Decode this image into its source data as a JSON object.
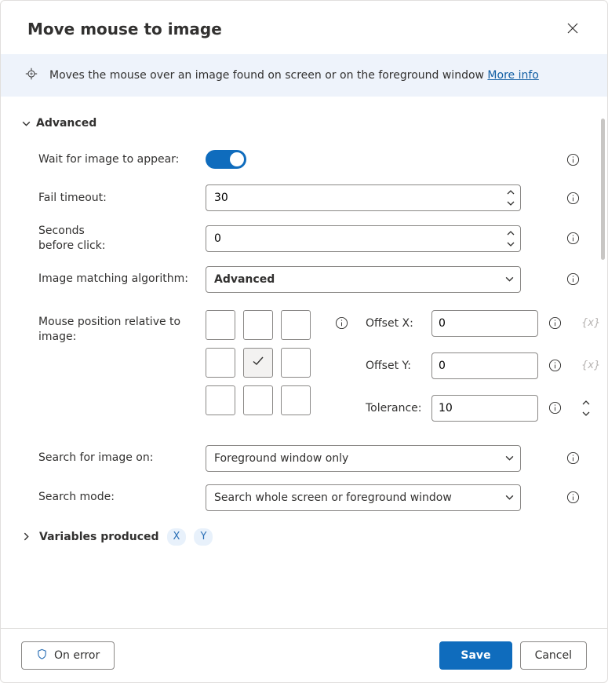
{
  "dialog": {
    "title": "Move mouse to image"
  },
  "banner": {
    "text": "Moves the mouse over an image found on screen or on the foreground window ",
    "more_info": "More info"
  },
  "sections": {
    "advanced": "Advanced",
    "variables_produced": "Variables produced"
  },
  "fields": {
    "wait_for_image": {
      "label": "Wait for image to appear:",
      "value": true
    },
    "fail_timeout": {
      "label": "Fail timeout:",
      "value": "30"
    },
    "seconds_before_click": {
      "label": "Seconds\nbefore click:",
      "value": "0"
    },
    "matching_algorithm": {
      "label": "Image matching algorithm:",
      "value": "Advanced"
    },
    "mouse_position": {
      "label": "Mouse position relative to image:",
      "selected_index": 4
    },
    "offset_x": {
      "label": "Offset X:",
      "value": "0",
      "placeholder": "{x}"
    },
    "offset_y": {
      "label": "Offset Y:",
      "value": "0",
      "placeholder": "{x}"
    },
    "tolerance": {
      "label": "Tolerance:",
      "value": "10"
    },
    "search_on": {
      "label": "Search for image on:",
      "value": "Foreground window only"
    },
    "search_mode": {
      "label": "Search mode:",
      "value": "Search whole screen or foreground window"
    }
  },
  "variables": {
    "x": "X",
    "y": "Y"
  },
  "footer": {
    "on_error": "On error",
    "save": "Save",
    "cancel": "Cancel"
  }
}
